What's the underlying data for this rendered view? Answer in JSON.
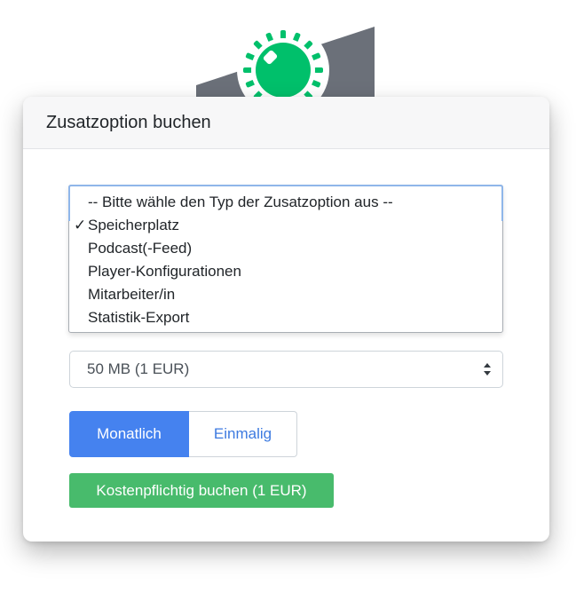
{
  "colors": {
    "accent_blue": "#4582ef",
    "success_green": "#48bb6c",
    "illustration_green": "#00c06b",
    "illustration_gray": "#6b7079"
  },
  "icons": {
    "illustration": "gear-knob-illustration",
    "select_arrows": "select-updown-arrows-icon",
    "checkmark": "checkmark-icon"
  },
  "card": {
    "title": "Zusatzoption buchen"
  },
  "type_select": {
    "options": [
      {
        "label": "-- Bitte wähle den Typ der Zusatzoption aus --",
        "checked": false
      },
      {
        "label": "Speicherplatz",
        "checked": true
      },
      {
        "label": "Podcast(-Feed)",
        "checked": false
      },
      {
        "label": "Player-Konfigurationen",
        "checked": false
      },
      {
        "label": "Mitarbeiter/in",
        "checked": false
      },
      {
        "label": "Statistik-Export",
        "checked": false
      }
    ],
    "check_mark": "✓"
  },
  "qty_select": {
    "value": "50 MB (1 EUR)"
  },
  "billing_toggle": {
    "monthly_label": "Monatlich",
    "once_label": "Einmalig",
    "selected": "Monatlich"
  },
  "book_button": {
    "label": "Kostenpflichtig buchen (1 EUR)"
  }
}
